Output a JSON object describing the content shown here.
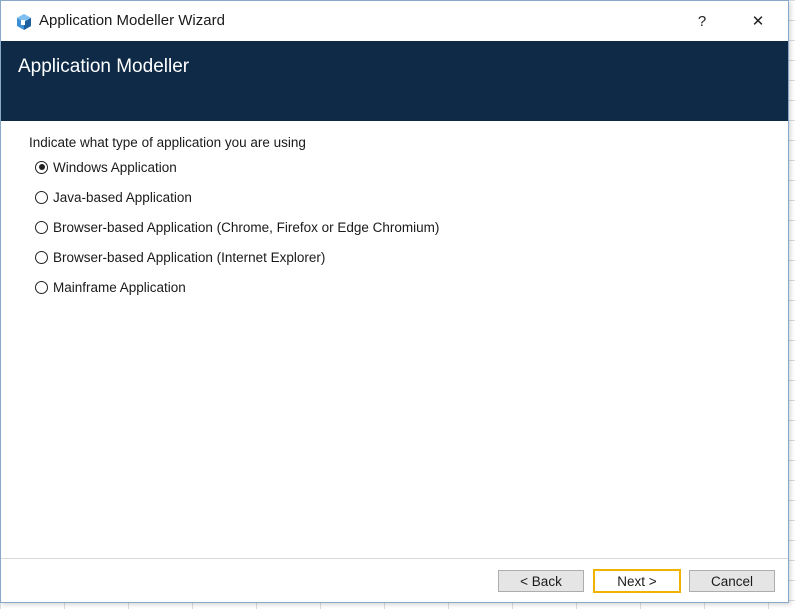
{
  "window": {
    "title": "Application Modeller Wizard",
    "app_icon": "cube-icon",
    "help_glyph": "?",
    "close_glyph": "✕"
  },
  "header": {
    "title": "Application Modeller",
    "background_color": "#0e2a47"
  },
  "content": {
    "prompt": "Indicate what type of application you are using",
    "options": [
      {
        "label": "Windows Application",
        "selected": true
      },
      {
        "label": "Java-based Application",
        "selected": false
      },
      {
        "label": "Browser-based Application (Chrome, Firefox or Edge Chromium)",
        "selected": false
      },
      {
        "label": "Browser-based Application (Internet Explorer)",
        "selected": false
      },
      {
        "label": "Mainframe Application",
        "selected": false
      }
    ]
  },
  "footer": {
    "back_label": "< Back",
    "next_label": "Next >",
    "cancel_label": "Cancel",
    "focus_color": "#f0b400"
  }
}
